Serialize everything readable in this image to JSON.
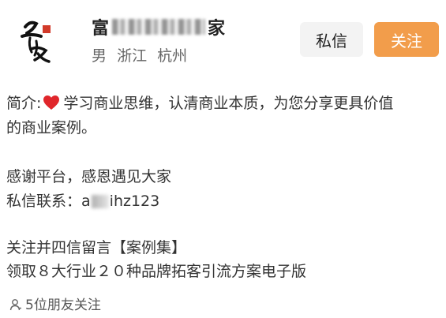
{
  "profile": {
    "name_first": "富",
    "name_last": "家",
    "gender": "男",
    "province": "浙江",
    "city": "杭州"
  },
  "buttons": {
    "message": "私信",
    "follow": "关注"
  },
  "bio": {
    "label": "简介:",
    "heart_icon": "red-heart-icon",
    "line1_text": "学习商业思维，认清商业本质，为您分享更具价值",
    "line2": "的商业案例。",
    "line3": "感谢平台，感恩遇见大家",
    "contact_label": "私信联系：",
    "contact_prefix": "a",
    "contact_suffix": "ihz123",
    "line5": "关注并四信留言【案例集】",
    "line6": "领取８大行业２０种品牌拓客引流方案电子版"
  },
  "friends": {
    "icon": "person-icon",
    "text": "5位朋友关注"
  },
  "colors": {
    "follow_button": "#f29d4b",
    "message_button": "#f3f3f3",
    "heart": "#e0262b"
  }
}
